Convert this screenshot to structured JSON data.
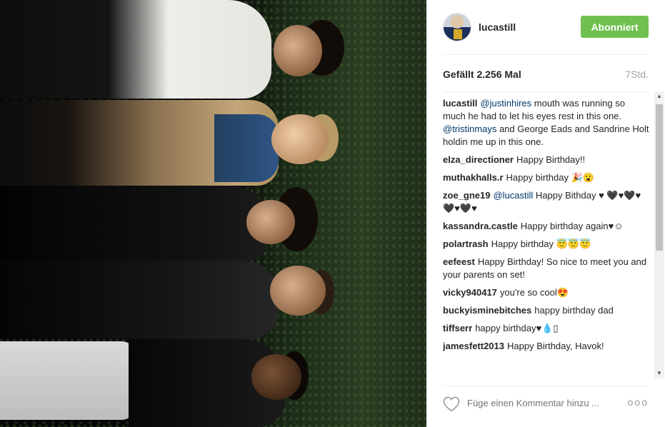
{
  "post": {
    "username": "lucastill",
    "follow_label": "Abonniert",
    "likes": "Gefällt 2.256 Mal",
    "time_ago": "7Std."
  },
  "caption": {
    "user": "lucastill",
    "parts": [
      {
        "type": "mention",
        "text": "@justinhires"
      },
      {
        "type": "text",
        "text": " mouth was running so much he had to let his eyes rest in this one. "
      },
      {
        "type": "mention",
        "text": "@tristinmays"
      },
      {
        "type": "text",
        "text": " and George Eads and Sandrine Holt holdin me up in this one."
      }
    ]
  },
  "comments": [
    {
      "user": "elza_directioner",
      "text": "Happy Birthday!!"
    },
    {
      "user": "muthakhalls.r",
      "text": "Happy birthday 🎉😮"
    },
    {
      "user": "zoe_gne19",
      "mention": "@lucastill",
      "text": " Happy Bithday ♥ 🖤♥🖤♥🖤♥🖤♥"
    },
    {
      "user": "kassandra.castle",
      "text": "Happy birthday again♥☺"
    },
    {
      "user": "polartrash",
      "text": "Happy birthday 😇😇😇"
    },
    {
      "user": "eefeest",
      "text": "Happy Birthday! So nice to meet you and your parents on set!"
    },
    {
      "user": "vicky940417",
      "text": "you're so cool😍"
    },
    {
      "user": "buckyisminebitches",
      "text": "happy birthday dad"
    },
    {
      "user": "tiffserr",
      "text": "happy birthday♥💧▯"
    },
    {
      "user": "jamesfett2013",
      "text": "Happy Birthday, Havok!"
    }
  ],
  "footer": {
    "comment_placeholder": "Füge einen Kommentar hinzu ...",
    "more_label": "ooo"
  },
  "icons": {
    "like": "heart-icon",
    "more": "more-options-icon"
  },
  "colors": {
    "follow_button": "#70c050",
    "mention": "#003569"
  }
}
